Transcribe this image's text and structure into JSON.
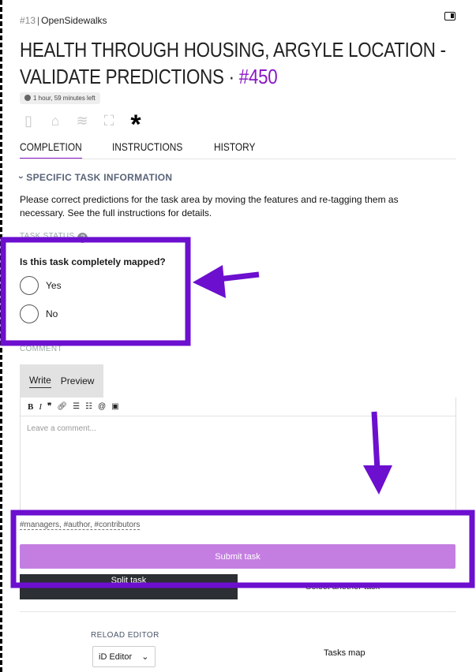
{
  "breadcrumb": {
    "task_number": "#13",
    "separator": "|",
    "org": "OpenSidewalks"
  },
  "title": {
    "text": "HEALTH THROUGH HOUSING, ARGYLE LOCATION - VALIDATE PREDICTIONS ·",
    "id": "#450"
  },
  "timer": {
    "text": "1 hour, 59 minutes left"
  },
  "tabs": [
    {
      "label": "COMPLETION",
      "active": true
    },
    {
      "label": "INSTRUCTIONS",
      "active": false
    },
    {
      "label": "HISTORY",
      "active": false
    }
  ],
  "section": {
    "label": "SPECIFIC TASK INFORMATION"
  },
  "description": "Please correct predictions for the task area by moving the features and re-tagging them as necessary. See the full instructions for details.",
  "task_status": {
    "label": "TASK STATUS",
    "help_icon": "?",
    "question": "Is this task completely mapped?",
    "options": [
      "Yes",
      "No"
    ]
  },
  "comment": {
    "label": "COMMENT",
    "tabs": {
      "write": "Write",
      "preview": "Preview"
    },
    "toolbar": [
      "B",
      "I",
      "99",
      "link",
      "ul",
      "ol",
      "@",
      "img"
    ],
    "placeholder": "Leave a comment...",
    "mentions": "#managers, #author, #contributors"
  },
  "actions": {
    "submit": "Submit task",
    "split": "Split task",
    "select_another": "Select another task"
  },
  "reload": {
    "label": "RELOAD EDITOR",
    "editor": "iD Editor"
  },
  "tasks_map": "Tasks map",
  "colors": {
    "accent": "#8a17c4",
    "submit": "#c47ee1",
    "annotation": "#6c0fcf"
  }
}
